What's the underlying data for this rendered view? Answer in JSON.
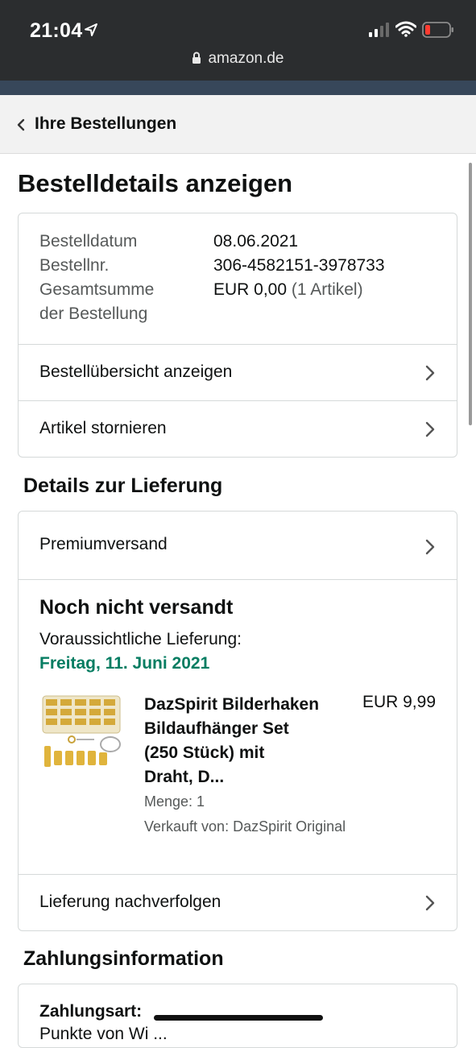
{
  "status_bar": {
    "time": "21:04"
  },
  "browser": {
    "url": "amazon.de"
  },
  "nav": {
    "back_label": "Ihre Bestellungen"
  },
  "page": {
    "title": "Bestelldetails anzeigen"
  },
  "order": {
    "date_label": "Bestelldatum",
    "date_value": "08.06.2021",
    "number_label": "Bestellnr.",
    "number_value": "306-4582151-3978733",
    "total_label_1": "Gesamtsumme",
    "total_label_2": "der Bestellung",
    "total_value": "EUR 0,00",
    "total_count": "(1 Artikel)",
    "overview_link": "Bestellübersicht anzeigen",
    "cancel_link": "Artikel stornieren"
  },
  "delivery": {
    "section_title": "Details zur Lieferung",
    "shipping_method": "Premiumversand",
    "status": "Noch nicht versandt",
    "expected_label": "Voraussichtliche Lieferung:",
    "expected_date": "Freitag, 11. Juni 2021",
    "item": {
      "title_lines": [
        "DazSpirit Bilderhaken",
        "Bildaufhänger Set",
        "(250 Stück) mit",
        "Draht, D..."
      ],
      "price": "EUR 9,99",
      "quantity": "Menge: 1",
      "seller": "Verkauft von: DazSpirit Original"
    },
    "track_link": "Lieferung nachverfolgen"
  },
  "payment": {
    "section_title": "Zahlungsinformation",
    "method_label": "Zahlungsart:",
    "partial_text": "Punkte von Wi  ..."
  },
  "colors": {
    "accent_green": "#067d62",
    "header_dark": "#2b2d2f",
    "nav_blue": "#37475a"
  }
}
